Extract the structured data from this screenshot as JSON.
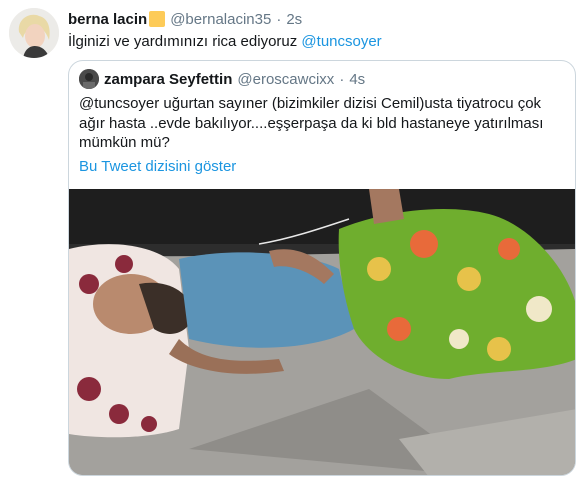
{
  "tweet": {
    "display_name": "berna lacin",
    "badge_emoji": "🟨",
    "handle": "@bernalacin35",
    "separator": "·",
    "time": "2s",
    "text_prefix": "İlginizi ve yardımınızı rica ediyoruz ",
    "mention": "@tuncsoyer"
  },
  "quoted_tweet": {
    "display_name": "zampara Seyfettin",
    "handle": "@eroscawcixx",
    "separator": "·",
    "time": "4s",
    "text": "@tuncsoyer uğurtan sayıner (bizimkiler dizisi Cemil)usta tiyatrocu çok ağır hasta ..evde bakılıyor....eşşerpaşa da ki bld hastaneye yatırılması mümkün mü?",
    "thread_link": "Bu Tweet dizisini göster"
  },
  "colors": {
    "link": "#1b95e0",
    "secondary_text": "#657786",
    "border": "#ccd6dd",
    "badge": "#fdcb58"
  }
}
